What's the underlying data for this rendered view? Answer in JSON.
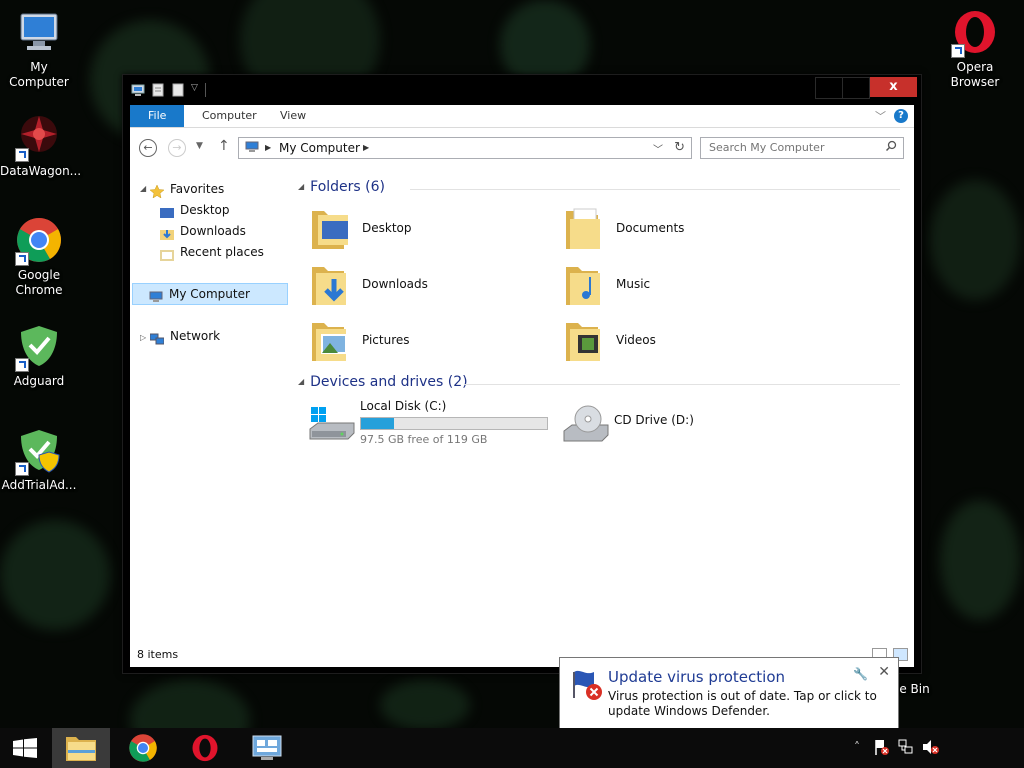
{
  "desktop": {
    "icons": [
      {
        "label": "My Computer",
        "icon": "computer-icon"
      },
      {
        "label": "DataWagon...",
        "icon": "datawagon-icon"
      },
      {
        "label": "Google Chrome",
        "icon": "chrome-icon"
      },
      {
        "label": "Adguard",
        "icon": "adguard-icon"
      },
      {
        "label": "AddTrialAd...",
        "icon": "addtrial-icon"
      },
      {
        "label": "Opera Browser",
        "icon": "opera-icon"
      }
    ],
    "recycle_partial": "le Bin"
  },
  "window": {
    "close_glyph": "x",
    "ribbon": {
      "tabs": [
        "File",
        "Computer",
        "View"
      ],
      "help": "?"
    },
    "address": {
      "location": "My Computer",
      "search_placeholder": "Search My Computer"
    },
    "nav": {
      "favorites": "Favorites",
      "desktop": "Desktop",
      "downloads": "Downloads",
      "recent": "Recent places",
      "my_computer": "My Computer",
      "network": "Network"
    },
    "folders_header": "Folders (6)",
    "folders": [
      "Desktop",
      "Documents",
      "Downloads",
      "Music",
      "Pictures",
      "Videos"
    ],
    "devices_header": "Devices and drives (2)",
    "drives": {
      "c_name": "Local Disk (C:)",
      "c_free": "97.5 GB free of 119 GB",
      "c_used_fraction": 0.18,
      "d_name": "CD Drive (D:)"
    },
    "status": "8 items"
  },
  "notification": {
    "title": "Update virus protection",
    "body": "Virus protection is out of date. Tap or click to update Windows Defender.",
    "close": "✕"
  },
  "colors": {
    "accent": "#1979ca",
    "header_text": "#1e3287",
    "close_red": "#c7302b",
    "drive_fill": "#26a0da"
  }
}
